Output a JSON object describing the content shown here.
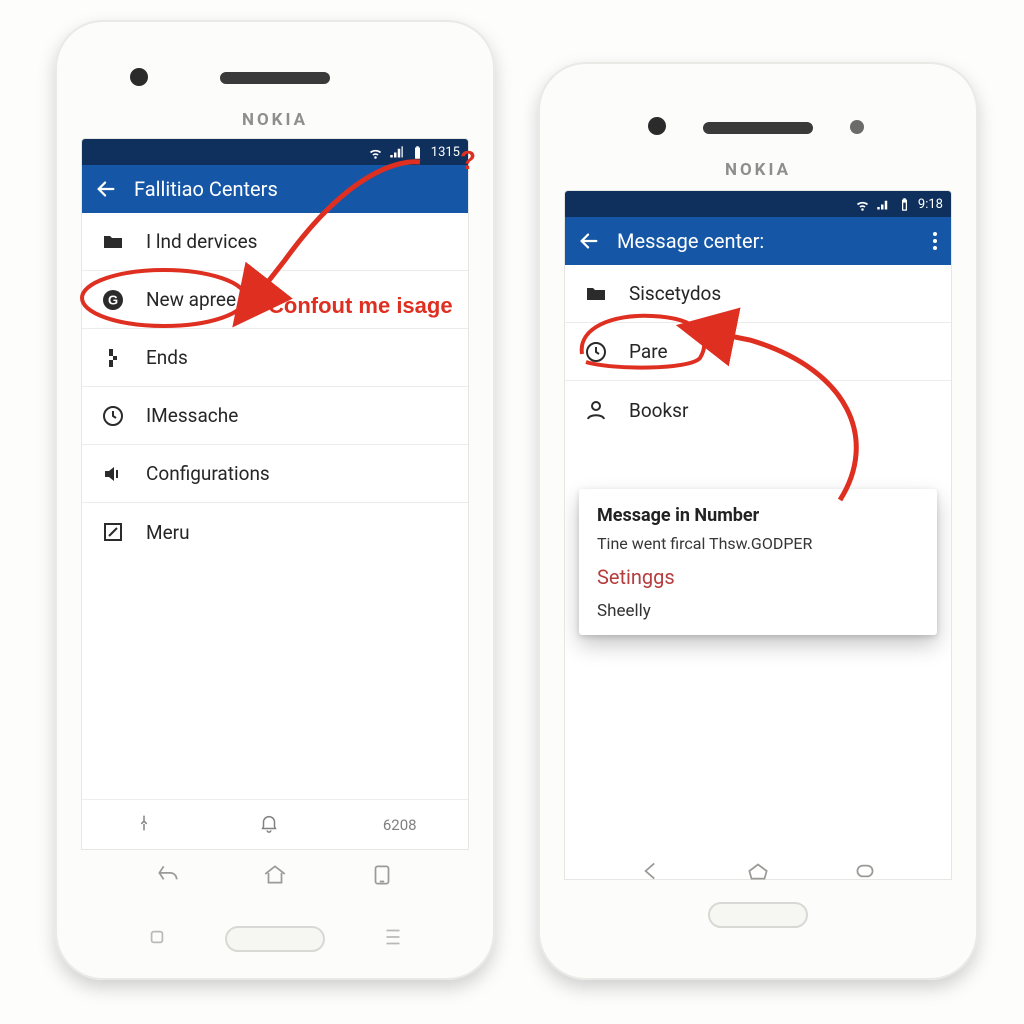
{
  "brand": "NOKIA",
  "left": {
    "status_time": "1315",
    "title": "Fallitiao Centers",
    "rows": [
      {
        "icon": "folder-icon",
        "label": "I lnd dervices"
      },
      {
        "icon": "g-badge-icon",
        "label": "New apree"
      },
      {
        "icon": "segments-icon",
        "label": "Ends"
      },
      {
        "icon": "clock-icon",
        "label": "IMessache"
      },
      {
        "icon": "speaker-icon",
        "label": "Configurations"
      },
      {
        "icon": "edit-box-icon",
        "label": "Meru"
      }
    ],
    "innerbar_number": "6208"
  },
  "right": {
    "status_time": "9:18",
    "title": "Message center:",
    "rows": [
      {
        "icon": "folder-icon",
        "label": "Siscetydos"
      },
      {
        "icon": "clock-icon",
        "label": "Pare"
      },
      {
        "icon": "person-icon",
        "label": "Booksr"
      }
    ],
    "card": {
      "title": "Message in Number",
      "line": "Tine went fircal Thsw.GODPER",
      "link": "Setinggs",
      "option": "Sheelly"
    }
  },
  "annotations": {
    "left_label": "Confout me isage",
    "question": "?"
  }
}
